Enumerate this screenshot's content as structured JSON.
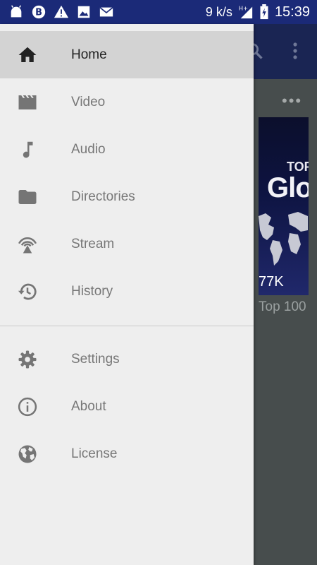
{
  "status_bar": {
    "speed": "9 k/s",
    "network": "H+",
    "time": "15:39",
    "icons": [
      "android-icon",
      "bitcoin-icon",
      "warning-icon",
      "image-icon",
      "mail-icon"
    ]
  },
  "app_bar": {
    "icons": [
      "search-icon",
      "more-vert-icon"
    ]
  },
  "content": {
    "more_label": "•••",
    "thumbnail": {
      "overlay_top": "TOP",
      "overlay_title": "Glo",
      "views": "77K"
    },
    "title": "Top 100"
  },
  "drawer": {
    "active_item": "Home",
    "items": [
      {
        "label": "Home",
        "icon": "home-icon"
      },
      {
        "label": "Video",
        "icon": "video-clapper-icon"
      },
      {
        "label": "Audio",
        "icon": "music-note-icon"
      },
      {
        "label": "Directories",
        "icon": "folder-icon"
      },
      {
        "label": "Stream",
        "icon": "stream-antenna-icon"
      },
      {
        "label": "History",
        "icon": "history-icon"
      }
    ],
    "secondary_items": [
      {
        "label": "Settings",
        "icon": "gear-icon"
      },
      {
        "label": "About",
        "icon": "info-icon"
      },
      {
        "label": "License",
        "icon": "globe-icon"
      }
    ]
  },
  "colors": {
    "status_bar": "#1b2a78",
    "drawer_bg": "#eeeeee",
    "drawer_active_bg": "#d3d3d3",
    "drawer_icon": "#757575"
  }
}
